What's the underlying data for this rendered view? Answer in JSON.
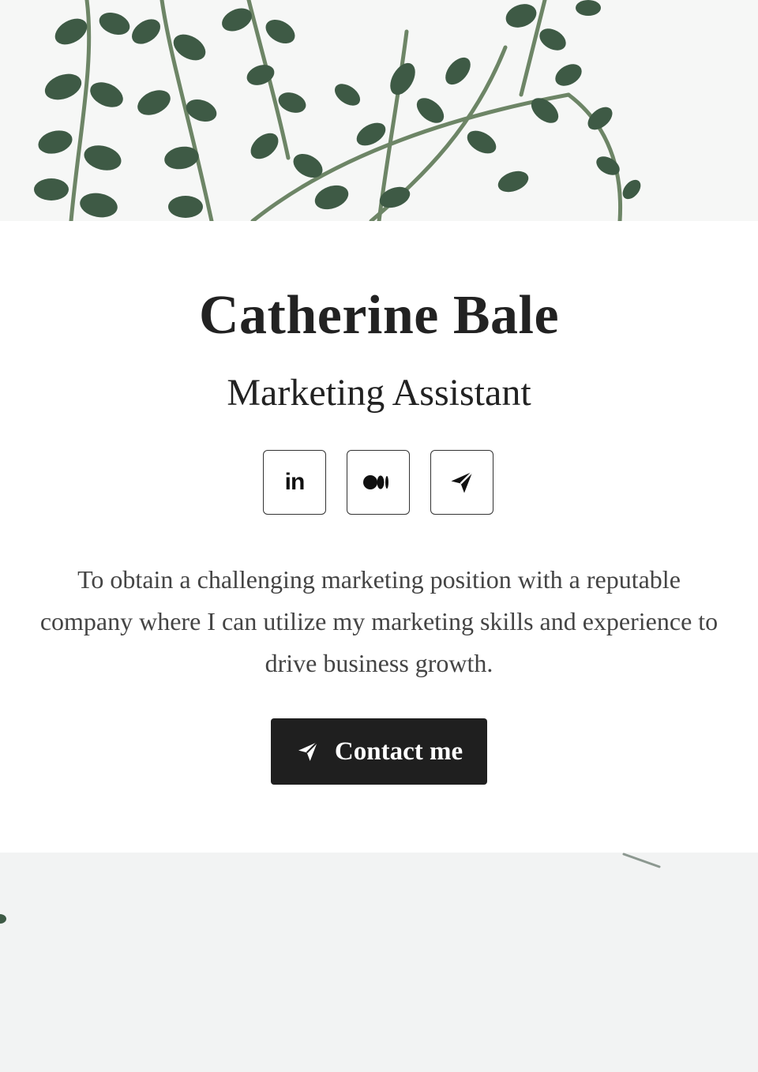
{
  "profile": {
    "name": "Catherine Bale",
    "title": "Marketing Assistant",
    "summary": "To obtain a challenging marketing position with a reputable company where I can utilize my marketing skills and experience to drive business growth."
  },
  "socials": [
    {
      "icon": "linkedin-icon",
      "label": "in"
    },
    {
      "icon": "medium-icon"
    },
    {
      "icon": "telegram-icon"
    }
  ],
  "contact": {
    "label": "Contact me",
    "icon": "send-icon"
  },
  "colors": {
    "text": "#222222",
    "button_bg": "#1f1f1f",
    "leaf": "#3e5a45",
    "stem": "#6d8566"
  }
}
